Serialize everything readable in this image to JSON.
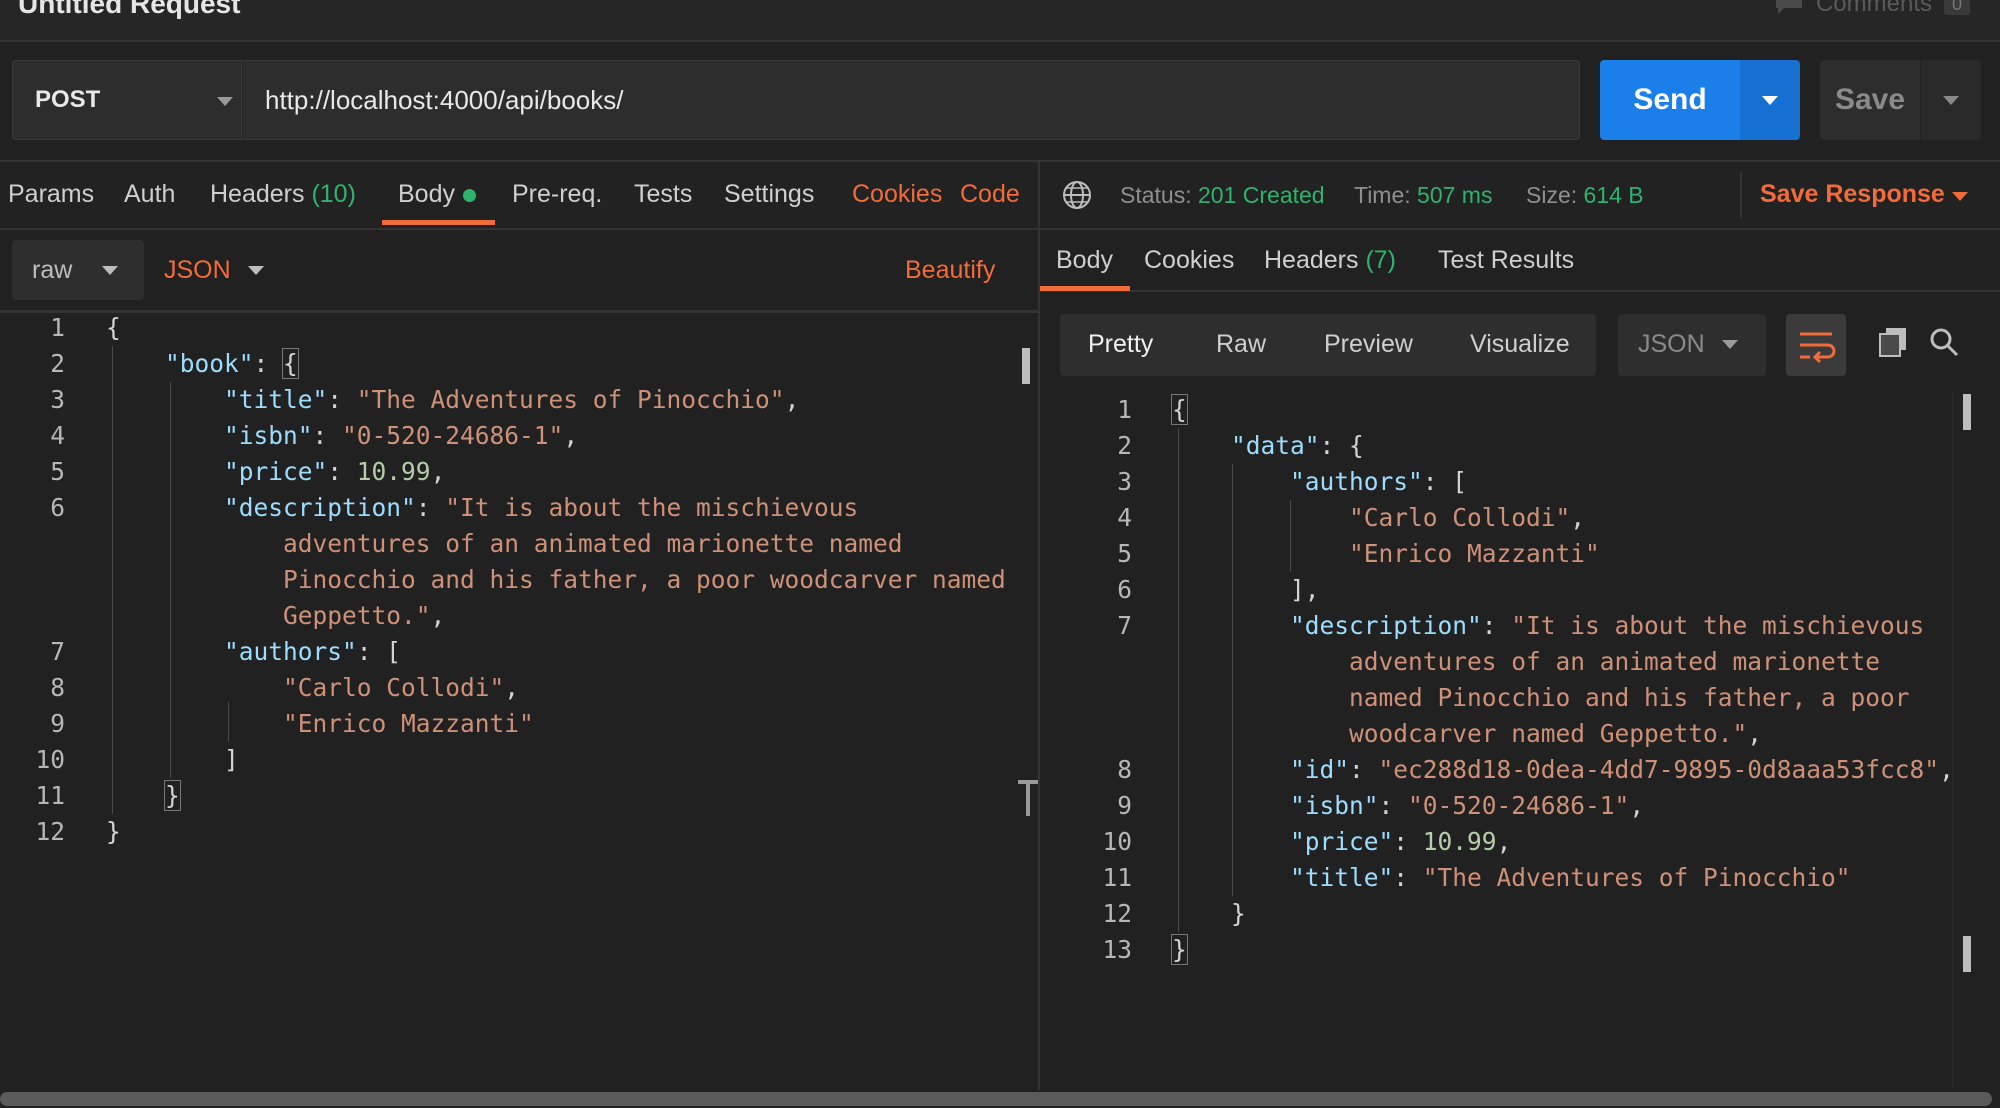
{
  "request": {
    "title": "Untitled Request",
    "comments_label": "Comments",
    "comments_count": "0"
  },
  "url_bar": {
    "method": "POST",
    "url": "http://localhost:4000/api/books/",
    "send_label": "Send",
    "save_label": "Save"
  },
  "request_tabs": {
    "params": "Params",
    "auth": "Auth",
    "headers": "Headers",
    "headers_count": "(10)",
    "body": "Body",
    "prereq": "Pre-req.",
    "tests": "Tests",
    "settings": "Settings",
    "cookies": "Cookies",
    "code": "Code"
  },
  "body_toolbar": {
    "mode": "raw",
    "language": "JSON",
    "beautify": "Beautify"
  },
  "response_meta": {
    "status_label": "Status:",
    "status_value": "201 Created",
    "time_label": "Time:",
    "time_value": "507 ms",
    "size_label": "Size:",
    "size_value": "614 B",
    "save_response": "Save Response"
  },
  "response_tabs": {
    "body": "Body",
    "cookies": "Cookies",
    "headers": "Headers",
    "headers_count": "(7)",
    "test_results": "Test Results"
  },
  "response_view": {
    "pretty": "Pretty",
    "raw": "Raw",
    "preview": "Preview",
    "visualize": "Visualize",
    "format": "JSON"
  },
  "request_body_lines": [
    "1",
    "2",
    "3",
    "4",
    "5",
    "6",
    "7",
    "8",
    "9",
    "10",
    "11",
    "12"
  ],
  "request_body": {
    "book_key": "\"book\"",
    "title_key": "\"title\"",
    "title_val": "\"The Adventures of Pinocchio\"",
    "isbn_key": "\"isbn\"",
    "isbn_val": "\"0-520-24686-1\"",
    "price_key": "\"price\"",
    "price_val": "10.99",
    "desc_key": "\"description\"",
    "desc_1": "\"It is about the mischievous",
    "desc_2": "adventures of an animated marionette named",
    "desc_3": "Pinocchio and his father, a poor woodcarver named",
    "desc_4": "Geppetto.\"",
    "authors_key": "\"authors\"",
    "author_1": "\"Carlo Collodi\"",
    "author_2": "\"Enrico Mazzanti\""
  },
  "response_body_lines": [
    "1",
    "2",
    "3",
    "4",
    "5",
    "6",
    "7",
    "8",
    "9",
    "10",
    "11",
    "12",
    "13"
  ],
  "response_body": {
    "data_key": "\"data\"",
    "authors_key": "\"authors\"",
    "author_1": "\"Carlo Collodi\"",
    "author_2": "\"Enrico Mazzanti\"",
    "desc_key": "\"description\"",
    "desc_1": "\"It is about the mischievous",
    "desc_2": "adventures of an animated marionette",
    "desc_3": "named Pinocchio and his father, a poor",
    "desc_4": "woodcarver named Geppetto.\"",
    "id_key": "\"id\"",
    "id_val": "\"ec288d18-0dea-4dd7-9895-0d8aaa53fcc8\"",
    "isbn_key": "\"isbn\"",
    "isbn_val": "\"0-520-24686-1\"",
    "price_key": "\"price\"",
    "price_val": "10.99",
    "title_key": "\"title\"",
    "title_val": "\"The Adventures of Pinocchio\""
  },
  "colors": {
    "accent_orange": "#f26b3a",
    "send_blue": "#1a7fe8",
    "success_green": "#2fb36c",
    "json_key": "#9cdcfe",
    "json_string": "#ce9178",
    "json_number": "#b5cea8"
  }
}
